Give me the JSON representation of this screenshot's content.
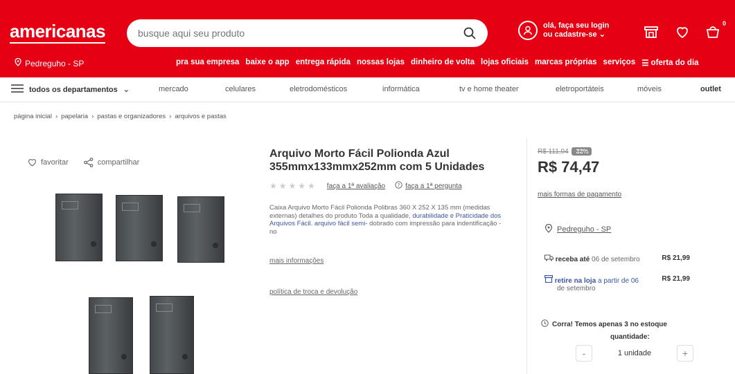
{
  "header": {
    "logo": "americanas",
    "search": {
      "placeholder": "busque aqui seu produto"
    },
    "login": {
      "line1": "olá, faça seu login",
      "line2": "ou cadastre-se"
    },
    "cart_count": "0",
    "location": "Pedreguho - SP",
    "nav": [
      "pra sua empresa",
      "baixe o app",
      "entrega rápida",
      "nossas lojas",
      "dinheiro de volta",
      "lojas oficiais",
      "marcas próprias",
      "serviços",
      "oferta do dia"
    ]
  },
  "departments": {
    "all_label": "todos os departamentos",
    "items": [
      "mercado",
      "celulares",
      "eletrodomésticos",
      "informática",
      "tv e home theater",
      "eletroportáteis",
      "móveis",
      "outlet"
    ]
  },
  "breadcrumb": [
    "página inicial",
    "papelaria",
    "pastas e organizadores",
    "arquivos e pastas"
  ],
  "actions": {
    "favorite": "favoritar",
    "share": "compartilhar"
  },
  "product": {
    "title": "Arquivo Morto Fácil Polionda Azul 355mmx133mmx252mm com 5 Unidades",
    "rating_link": "faça a 1ª avaliação",
    "question_link": "faça a 1ª pergunta",
    "desc_part1": "Caixa Arquivo Morto Fácil Polionda Polibras 360 X 252 X 135 mm (medidas externas) detalhes do produto Toda a qualidade,",
    "desc_highlight": "durabilidade e Praticidade dos Arquivos Fácil. arquivo fácil semi-",
    "desc_part2": "dobrado com impressão para indentificação - no",
    "more_info": "mais informações",
    "policy": "política de troca e devolução"
  },
  "buybox": {
    "old_price": "R$ 111,04",
    "discount": "-33%",
    "price": "R$ 74,47",
    "payment_link": "mais formas de pagamento",
    "cep": "Pedreguho - SP",
    "delivery_label": "receba até",
    "delivery_date": "06 de setembro",
    "delivery_price": "R$ 21,99",
    "pickup_label": "retire na loja",
    "pickup_date_1": "a partir de 06",
    "pickup_date_2": "de setembro",
    "pickup_price": "R$ 21,99",
    "stock": "Corra! Temos apenas 3 no estoque",
    "qty_label": "quantidade:",
    "qty_value": "1 unidade",
    "minus": "-",
    "plus": "+"
  }
}
